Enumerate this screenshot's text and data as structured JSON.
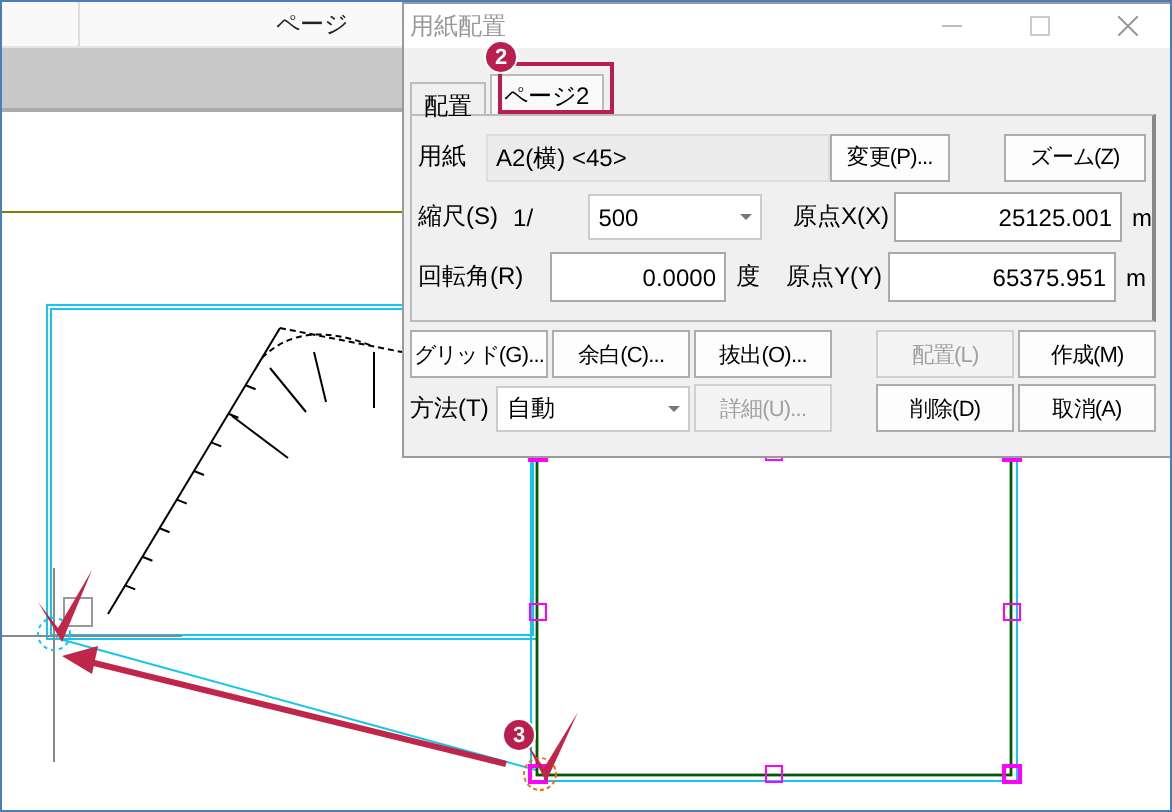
{
  "app_header": {
    "column_label": "ページ"
  },
  "dialog": {
    "title": "用紙配置",
    "tabs": [
      {
        "label": "配置",
        "selected": false
      },
      {
        "label": "ページ2",
        "selected": true
      }
    ],
    "paper": {
      "label": "用紙",
      "value": "A2(横) <45>",
      "change_button": "変更(P)...",
      "zoom_button": "ズーム(Z)"
    },
    "scale": {
      "label": "縮尺(S)",
      "prefix": "1/",
      "value": "500"
    },
    "origin_x": {
      "label": "原点X(X)",
      "value": "25125.001",
      "unit": "m"
    },
    "rotation": {
      "label": "回転角(R)",
      "value": "0.0000",
      "unit": "度"
    },
    "origin_y": {
      "label": "原点Y(Y)",
      "value": "65375.951",
      "unit": "m"
    },
    "buttons_row1": [
      {
        "label": "グリッド(G)...",
        "disabled": false
      },
      {
        "label": "余白(C)...",
        "disabled": false
      },
      {
        "label": "抜出(O)...",
        "disabled": false
      },
      {
        "label": "配置(L)",
        "disabled": true
      },
      {
        "label": "作成(M)",
        "disabled": false
      }
    ],
    "method": {
      "label": "方法(T)",
      "value": "自動"
    },
    "buttons_row2": [
      {
        "label": "詳細(U)...",
        "disabled": true
      },
      {
        "label": "削除(D)",
        "disabled": false
      },
      {
        "label": "取消(A)",
        "disabled": false
      }
    ]
  },
  "annotations": [
    {
      "label": "2"
    },
    {
      "label": "3"
    }
  ]
}
